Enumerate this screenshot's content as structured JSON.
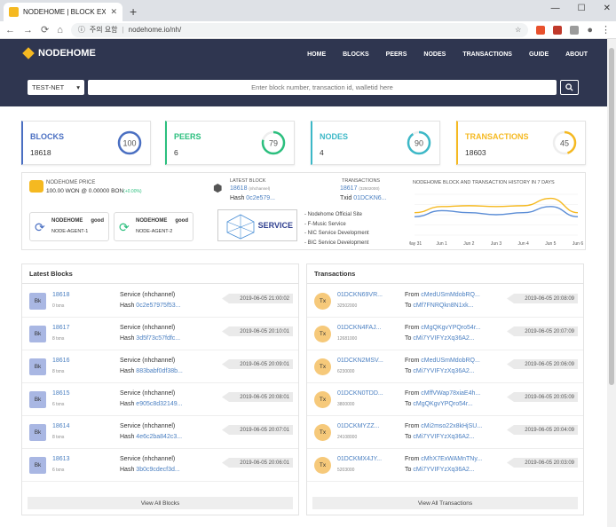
{
  "browser": {
    "tab_title": "NODEHOME | BLOCK EXPLORER",
    "url_security": "주의 요함",
    "url": "nodehome.io/nh/"
  },
  "header": {
    "logo": "NODEHOME",
    "nav": [
      "HOME",
      "BLOCKS",
      "PEERS",
      "NODES",
      "TRANSACTIONS",
      "GUIDE",
      "ABOUT"
    ],
    "network": "TEST-NET",
    "search_placeholder": "Enter block number, transaction id, walletid here"
  },
  "stats": [
    {
      "label": "BLOCKS",
      "value": "18618",
      "ring": "100",
      "color": "#4a6fc2",
      "fraction": 1.0
    },
    {
      "label": "PEERS",
      "value": "6",
      "ring": "79",
      "color": "#2bbf7e",
      "fraction": 0.79
    },
    {
      "label": "NODES",
      "value": "4",
      "ring": "90",
      "color": "#3cb8c7",
      "fraction": 0.9
    },
    {
      "label": "TRANSACTIONS",
      "value": "18603",
      "ring": "45",
      "color": "#f5b921",
      "fraction": 0.45
    }
  ],
  "info": {
    "price_label": "NODEHOME PRICE",
    "price_value": "100.00 WON @ 0.00000 BON",
    "price_change": "(+0.00%)",
    "agents": [
      {
        "name": "NODEHOME",
        "status": "good",
        "id": "NODE-AGENT-1"
      },
      {
        "name": "NODEHOME",
        "status": "good",
        "id": "NODE-AGENT-2"
      }
    ],
    "latest_block_label": "LATEST BLOCK",
    "latest_block_num": "18618",
    "latest_block_channel": "(nhchannel)",
    "latest_block_hash_label": "Hash",
    "latest_block_hash": "0c2e579...",
    "transactions_label": "TRANSACTIONS",
    "tx_count": "18617",
    "tx_small": "(32502000)",
    "txid_label": "Txid",
    "txid": "01DCKN6...",
    "service_label": "SERVICE",
    "services": [
      "Nodehome Official Site",
      "F-Music Service",
      "NIC Service Development",
      "BIC Service Development"
    ],
    "chart_title": "NODEHOME BLOCK AND TRANSACTION HISTORY IN 7 DAYS"
  },
  "chart_data": {
    "type": "line",
    "categories": [
      "May 31",
      "Jun 1",
      "Jun 2",
      "Jun 3",
      "Jun 4",
      "Jun 5",
      "Jun 6"
    ],
    "series": [
      {
        "values": [
          0.55,
          0.7,
          0.72,
          0.7,
          0.72,
          0.9,
          0.55
        ],
        "color": "#f5b921"
      },
      {
        "values": [
          0.45,
          0.6,
          0.55,
          0.5,
          0.55,
          0.7,
          0.45
        ],
        "color": "#5b8dd6"
      }
    ]
  },
  "blocks": {
    "title": "Latest Blocks",
    "view_all": "View All Blocks",
    "rows": [
      {
        "icon": "Bk",
        "num": "18618",
        "tx": "0 txns",
        "service": "Service (nhchannel)",
        "hash_label": "Hash",
        "hash": "0c2e57975f53...",
        "time": "2019-06-05 21:00:02"
      },
      {
        "icon": "Bk",
        "num": "18617",
        "tx": "8 txns",
        "service": "Service (nhchannel)",
        "hash_label": "Hash",
        "hash": "3d5f73c57fdfc...",
        "time": "2019-06-05 20:10:01"
      },
      {
        "icon": "Bk",
        "num": "18616",
        "tx": "8 txns",
        "service": "Service (nhchannel)",
        "hash_label": "Hash",
        "hash": "883babf0df38b...",
        "time": "2019-06-05 20:09:01"
      },
      {
        "icon": "Bk",
        "num": "18615",
        "tx": "6 txns",
        "service": "Service (nhchannel)",
        "hash_label": "Hash",
        "hash": "e905c8d32149...",
        "time": "2019-06-05 20:08:01"
      },
      {
        "icon": "Bk",
        "num": "18614",
        "tx": "8 txns",
        "service": "Service (nhchannel)",
        "hash_label": "Hash",
        "hash": "4e6c2ba842c3...",
        "time": "2019-06-05 20:07:01"
      },
      {
        "icon": "Bk",
        "num": "18613",
        "tx": "6 txns",
        "service": "Service (nhchannel)",
        "hash_label": "Hash",
        "hash": "3b0c9cdecf3d...",
        "time": "2019-06-05 20:06:01"
      }
    ]
  },
  "transactions": {
    "title": "Transactions",
    "view_all": "View All Transactions",
    "rows": [
      {
        "icon": "Tx",
        "id": "01DCKN69VR...",
        "amount": "32502000",
        "from_label": "From",
        "from": "cMedUSmMdobRQ...",
        "to_label": "To",
        "to": "cMf7FNRQkn8N1xk...",
        "time": "2019-06-05 20:08:09"
      },
      {
        "icon": "Tx",
        "id": "01DCKN4FAJ...",
        "amount": "12681000",
        "from_label": "From",
        "from": "cMgQKgvYPQro54r...",
        "to_label": "To",
        "to": "cMi7YVIFYzXq36A2...",
        "time": "2019-06-05 20:07:09"
      },
      {
        "icon": "Tx",
        "id": "01DCKN2MSV...",
        "amount": "6230000",
        "from_label": "From",
        "from": "cMedUSmMdobRQ...",
        "to_label": "To",
        "to": "cMi7YVIFYzXq36A2...",
        "time": "2019-06-05 20:06:09"
      },
      {
        "icon": "Tx",
        "id": "01DCKN0TDD...",
        "amount": "3800000",
        "from_label": "From",
        "from": "cMffVWap78xiaE4h...",
        "to_label": "To",
        "to": "cMgQKgvYPQro54r...",
        "time": "2019-06-05 20:05:09"
      },
      {
        "icon": "Tx",
        "id": "01DCKMYZZ...",
        "amount": "24108000",
        "from_label": "From",
        "from": "cMi2mso22x8kHjSU...",
        "to_label": "To",
        "to": "cMi7YVIFYzXq36A2...",
        "time": "2019-06-05 20:04:09"
      },
      {
        "icon": "Tx",
        "id": "01DCKMX4JY...",
        "amount": "5203000",
        "from_label": "From",
        "from": "cMhX7ExWAMnTNy...",
        "to_label": "To",
        "to": "cMi7YVIFYzXq36A2...",
        "time": "2019-06-05 20:03:09"
      }
    ]
  }
}
